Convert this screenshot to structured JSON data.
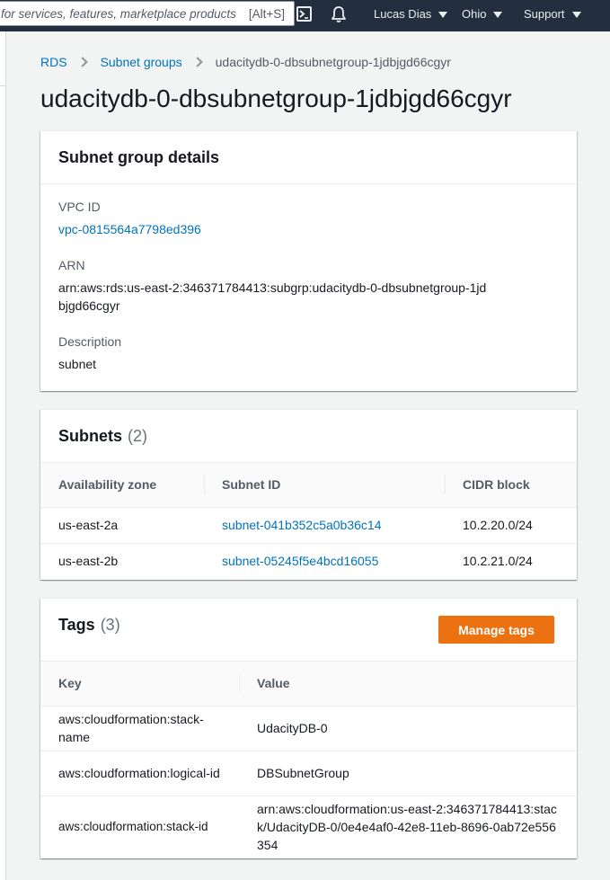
{
  "topnav": {
    "search_placeholder": "for services, features, marketplace products",
    "search_shortcut": "[Alt+S]",
    "user": "Lucas Dias",
    "region": "Ohio",
    "support": "Support",
    "icons": [
      "cloudshell-icon",
      "bell-icon",
      "caret-down-icon"
    ]
  },
  "breadcrumb": {
    "items": [
      "RDS",
      "Subnet groups"
    ],
    "current": "udacitydb-0-dbsubnetgroup-1jdbjgd66cgyr"
  },
  "page_title": "udacitydb-0-dbsubnetgroup-1jdbjgd66cgyr",
  "details": {
    "title": "Subnet group details",
    "vpc_label": "VPC ID",
    "vpc_value": "vpc-0815564a7798ed396",
    "arn_label": "ARN",
    "arn_value": "arn:aws:rds:us-east-2:346371784413:subgrp:udacitydb-0-dbsubnetgroup-1jdbjgd66cgyr",
    "desc_label": "Description",
    "desc_value": "subnet"
  },
  "subnets": {
    "title": "Subnets",
    "count": "(2)",
    "columns": [
      "Availability zone",
      "Subnet ID",
      "CIDR block"
    ],
    "rows": [
      {
        "az": "us-east-2a",
        "id": "subnet-041b352c5a0b36c14",
        "cidr": "10.2.20.0/24"
      },
      {
        "az": "us-east-2b",
        "id": "subnet-05245f5e4bcd16055",
        "cidr": "10.2.21.0/24"
      }
    ]
  },
  "tags": {
    "title": "Tags",
    "count": "(3)",
    "manage_label": "Manage tags",
    "columns": [
      "Key",
      "Value"
    ],
    "rows": [
      {
        "key": "aws:cloudformation:stack-name",
        "value": "UdacityDB-0"
      },
      {
        "key": "aws:cloudformation:logical-id",
        "value": "DBSubnetGroup"
      },
      {
        "key": "aws:cloudformation:stack-id",
        "value": "arn:aws:cloudformation:us-east-2:346371784413:stack/UdacityDB-0/0e4e4af0-42e8-11eb-8696-0ab72e556354"
      }
    ]
  },
  "colors": {
    "nav_bg": "#232f3e",
    "link": "#0073bb",
    "primary_button": "#ec7211"
  }
}
